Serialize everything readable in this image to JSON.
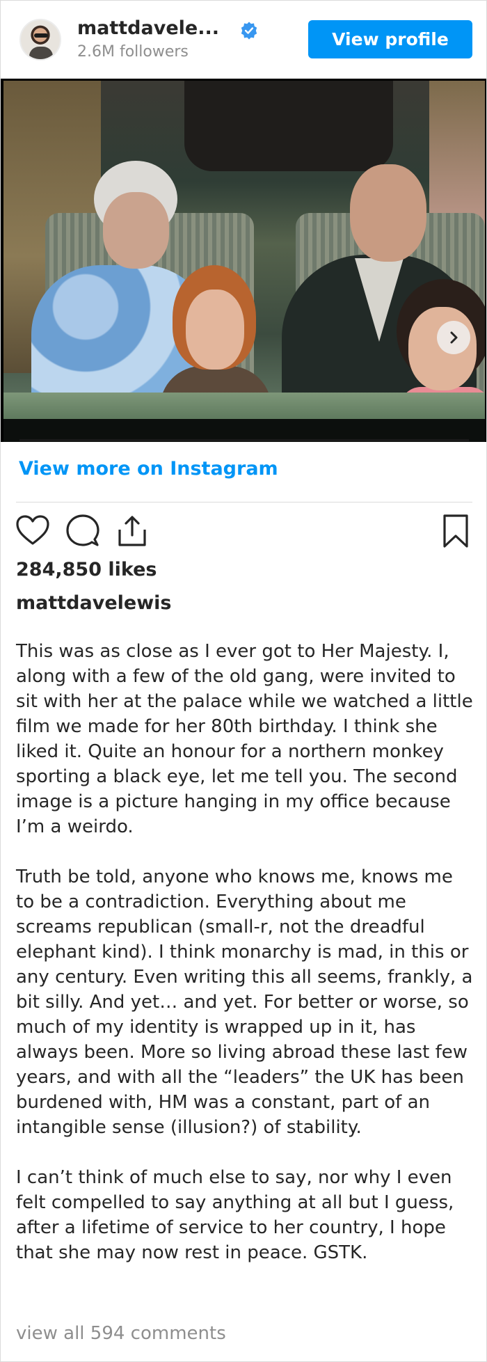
{
  "header": {
    "username": "mattdavele...",
    "followers": "2.6M followers",
    "view_profile_label": "View profile"
  },
  "media": {
    "carousel_count": 2,
    "active_index": 0
  },
  "view_more_label": "View more on Instagram",
  "likes": "284,850 likes",
  "caption": {
    "username": "mattdavelewis",
    "paragraphs": [
      "This was as close as I ever got to Her Majesty. I, along with a few of the old gang, were invited to sit with her at the palace while we watched a little film we made for her 80th birthday. I think she liked it. Quite an honour for a northern monkey sporting a black eye, let me tell you. The second image is a picture hanging in my office because I’m a weirdo.",
      "Truth be told, anyone who knows me, knows me to be a contradiction. Everything about me screams republican (small-r, not the dreadful elephant kind). I think monarchy is mad, in this or any century. Even writing this all seems, frankly, a bit silly. And yet… and yet. For better or worse, so much of my identity is wrapped up in it, has always been. More so living abroad these last few years, and with all the “leaders” the UK has been burdened with, HM was a constant, part of an intangible sense (illusion?) of stability.",
      "I can’t think of much else to say, nor why I even felt compelled to say anything at all but I guess, after a lifetime of service to her country, I hope that she may now rest in peace. GSTK."
    ]
  },
  "comments_link": "view all 594 comments",
  "colors": {
    "accent": "#0095f6",
    "text": "#262626",
    "muted": "#8e8e8e",
    "divider": "#dbdbdb"
  },
  "icons": [
    "verified-badge-icon",
    "chevron-right-icon",
    "heart-icon",
    "comment-icon",
    "share-icon",
    "bookmark-icon"
  ]
}
